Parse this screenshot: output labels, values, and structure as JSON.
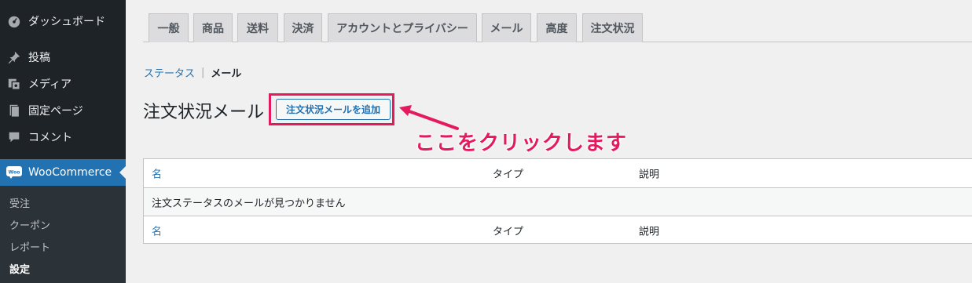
{
  "sidebar": {
    "items": [
      {
        "label": "ダッシュボード",
        "icon": "dashboard-icon"
      },
      {
        "label": "投稿",
        "icon": "pushpin-icon"
      },
      {
        "label": "メディア",
        "icon": "media-icon"
      },
      {
        "label": "固定ページ",
        "icon": "page-icon"
      },
      {
        "label": "コメント",
        "icon": "comment-icon"
      },
      {
        "label": "WooCommerce",
        "icon": "woo-icon"
      }
    ],
    "woo_badge": "Woo",
    "submenu": [
      "受注",
      "クーポン",
      "レポート",
      "設定"
    ]
  },
  "tabs": [
    "一般",
    "商品",
    "送料",
    "決済",
    "アカウントとプライバシー",
    "メール",
    "高度",
    "注文状況"
  ],
  "breadcrumb": {
    "link": "ステータス",
    "separator": "|",
    "current": "メール"
  },
  "page": {
    "title": "注文状況メール",
    "add_button": "注文状況メールを追加"
  },
  "annotation": {
    "text": "ここをクリックします",
    "color": "#e5195e"
  },
  "table": {
    "columns": [
      "名",
      "タイプ",
      "説明"
    ],
    "empty_message": "注文ステータスのメールが見つかりません"
  },
  "colors": {
    "accent": "#2271b1",
    "sidebar": "#1d2327",
    "annotation": "#e5195e"
  }
}
